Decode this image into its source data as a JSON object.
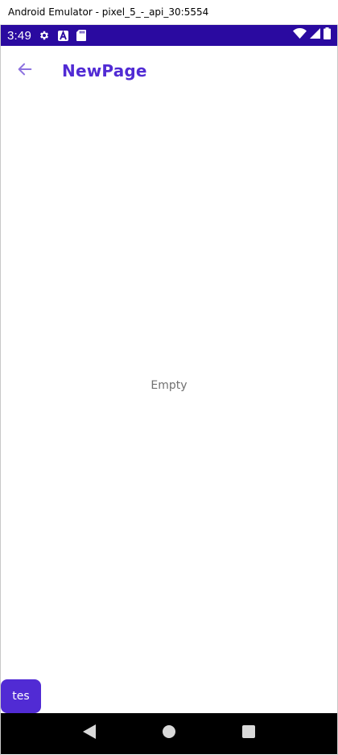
{
  "window": {
    "title": "Android Emulator - pixel_5_-_api_30:5554"
  },
  "status_bar": {
    "time": "3:49",
    "left_icons": [
      "gear-icon",
      "a-badge-icon",
      "sd-card-icon"
    ],
    "right_icons": [
      "wifi-icon",
      "signal-icon",
      "battery-icon"
    ],
    "background_color": "#2a0aa0"
  },
  "app_bar": {
    "back_icon": "arrow-left-icon",
    "title": "NewPage",
    "accent_color": "#512bd4"
  },
  "content": {
    "empty_message": "Empty"
  },
  "fab": {
    "label": "tes",
    "color": "#512bd4"
  },
  "nav_bar": {
    "buttons": [
      "back-triangle-icon",
      "home-circle-icon",
      "recents-square-icon"
    ]
  }
}
